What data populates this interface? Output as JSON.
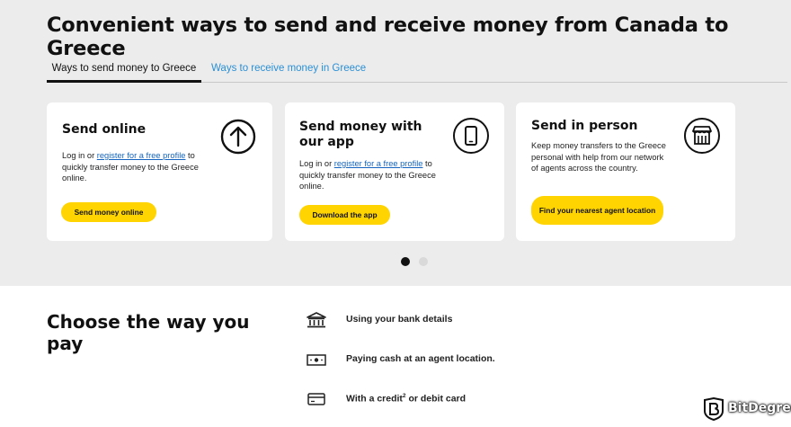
{
  "page_title": "Convenient ways to send and receive money from Canada to Greece",
  "tabs": [
    {
      "label": "Ways to send money to Greece",
      "active": true
    },
    {
      "label": "Ways to receive money in Greece",
      "active": false
    }
  ],
  "cards": [
    {
      "title": "Send online",
      "text_before": "Log in or ",
      "link": "register for a free profile",
      "text_after": " to quickly transfer money to the Greece online.",
      "button": "Send money online",
      "icon": "arrow-up-circle-icon"
    },
    {
      "title": "Send money with our app",
      "text_before": "Log in or ",
      "link": "register for a free profile",
      "text_after": " to quickly transfer money to the Greece online.",
      "button": "Download the app",
      "icon": "smartphone-icon"
    },
    {
      "title": "Send in person",
      "text": "Keep money transfers to the Greece personal with help from our network of agents across the country.",
      "button": "Find your nearest agent location",
      "icon": "storefront-icon"
    }
  ],
  "carousel": {
    "pages": 2,
    "current": 1
  },
  "choose": {
    "title": "Choose the way you pay",
    "options": [
      {
        "label": "Using your bank details",
        "icon": "bank-icon"
      },
      {
        "label": "Paying cash at an agent location.",
        "icon": "cash-icon"
      },
      {
        "label_before": "With a credit",
        "superscript": "2",
        "label_after": " or debit card",
        "icon": "credit-card-icon"
      }
    ]
  },
  "watermark": {
    "text": "BitDegree"
  },
  "colors": {
    "accent_yellow": "#ffd400",
    "link_blue": "#2a8fd6",
    "background_grey": "#ececec"
  }
}
